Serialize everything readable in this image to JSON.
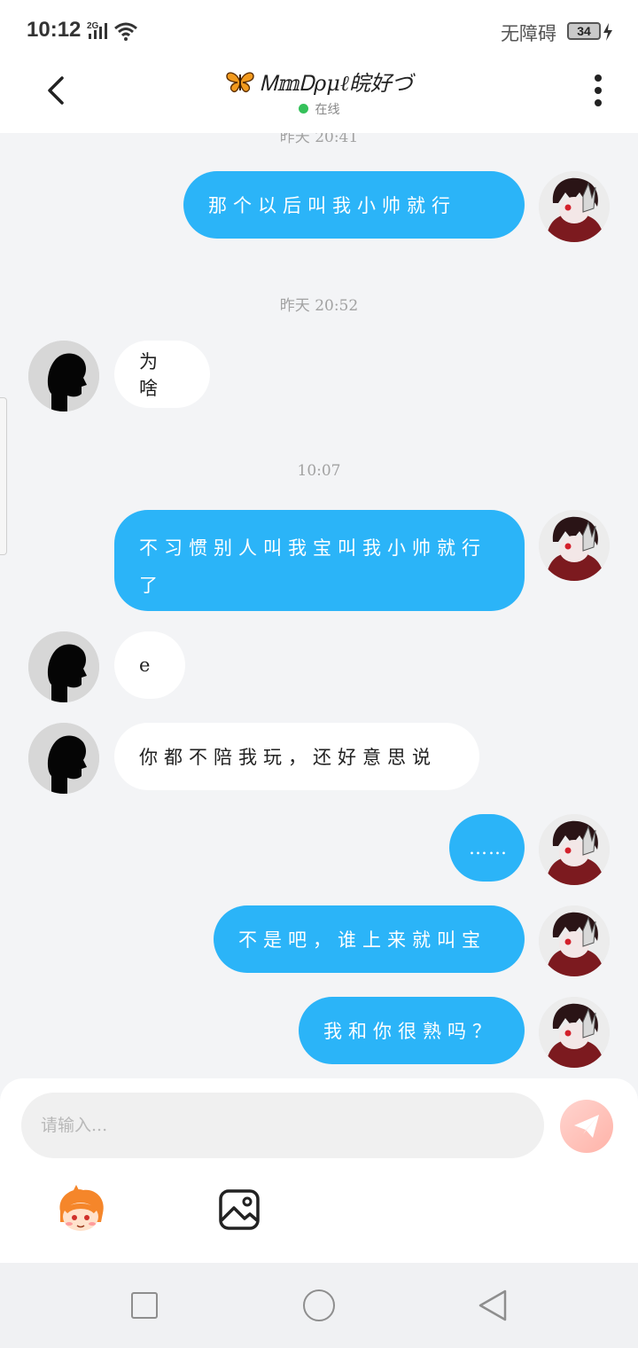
{
  "status_bar": {
    "time": "10:12",
    "network": "2G",
    "accessibility": "无障碍",
    "battery": "34"
  },
  "header": {
    "title": "Ꮇ𝕞Ꭰρμℓ皖好づ",
    "status": "在线"
  },
  "messages": [
    {
      "kind": "timestamp",
      "text": "昨天 20:41"
    },
    {
      "kind": "message",
      "from": "me",
      "text": "那个以后叫我小帅就行"
    },
    {
      "kind": "timestamp",
      "text": "昨天 20:52"
    },
    {
      "kind": "message",
      "from": "other",
      "text": "为啥"
    },
    {
      "kind": "timestamp",
      "text": "10:07"
    },
    {
      "kind": "message",
      "from": "me",
      "text": "不习惯别人叫我宝叫我小帅就行了"
    },
    {
      "kind": "message",
      "from": "other",
      "text": "e"
    },
    {
      "kind": "message",
      "from": "other",
      "text": "你都不陪我玩，还好意思说"
    },
    {
      "kind": "message",
      "from": "me",
      "text": "……"
    },
    {
      "kind": "message",
      "from": "me",
      "text": "不是吧，谁上来就叫宝"
    },
    {
      "kind": "message",
      "from": "me",
      "text": "我和你很熟吗？"
    }
  ],
  "input": {
    "placeholder": "请输入..."
  },
  "icons": {
    "back": "chevron-left-icon",
    "more": "more-vertical-icon",
    "send": "send-icon",
    "emoji": "emoji-icon",
    "image": "image-icon"
  },
  "colors": {
    "my_bubble": "#2bb4f8",
    "other_bubble": "#ffffff",
    "online": "#35c15a",
    "background": "#f3f4f6"
  }
}
